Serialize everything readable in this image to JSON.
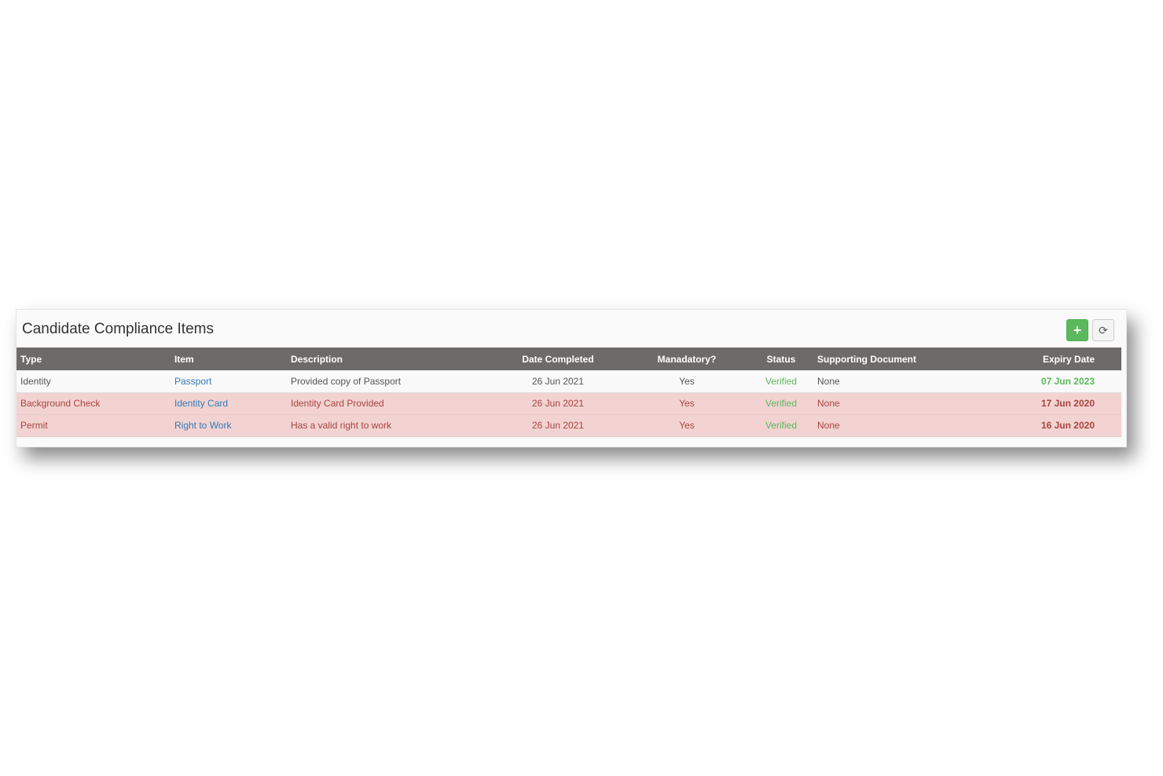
{
  "panel": {
    "title": "Candidate Compliance Items",
    "add_button_label": "+",
    "refresh_button_label": "⟳",
    "add_icon": "plus-icon",
    "refresh_icon": "refresh-icon"
  },
  "table": {
    "headers": {
      "type": "Type",
      "item": "Item",
      "description": "Description",
      "date_completed": "Date Completed",
      "mandatory": "Manadatory?",
      "status": "Status",
      "supporting_document": "Supporting Document",
      "expiry_date": "Expiry Date"
    },
    "rows": [
      {
        "type": "Identity",
        "item": "Passport",
        "description": "Provided copy of Passport",
        "date_completed": "26 Jun 2021",
        "mandatory": "Yes",
        "status": "Verified",
        "supporting_document": "None",
        "expiry_date": "07 Jun 2023"
      },
      {
        "type": "Background Check",
        "item": "Identity Card",
        "description": "Identity Card Provided",
        "date_completed": "26 Jun 2021",
        "mandatory": "Yes",
        "status": "Verified",
        "supporting_document": "None",
        "expiry_date": "17 Jun 2020"
      },
      {
        "type": "Permit",
        "item": "Right to Work",
        "description": "Has a valid right to work",
        "date_completed": "26 Jun 2021",
        "mandatory": "Yes",
        "status": "Verified",
        "supporting_document": "None",
        "expiry_date": "16 Jun 2020"
      }
    ]
  },
  "colors": {
    "header_bg": "#6d6b6a",
    "expired_row_bg": "#f2d3d1",
    "expired_text": "#a94442",
    "valid_green": "#5cb85c",
    "link_blue": "#337ab7"
  }
}
